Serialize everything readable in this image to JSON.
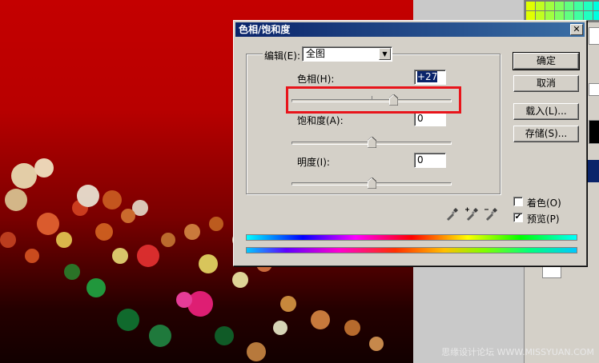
{
  "dialog": {
    "title": "色相/饱和度",
    "close_glyph": "✕",
    "edit_label": "编辑(E):",
    "edit_value": "全图",
    "hue_label": "色相(H):",
    "hue_value": "+27",
    "saturation_label": "饱和度(A):",
    "saturation_value": "0",
    "lightness_label": "明度(I):",
    "lightness_value": "0",
    "buttons": {
      "ok": "确定",
      "cancel": "取消",
      "load": "载入(L)...",
      "save": "存储(S)..."
    },
    "colorize_label": "着色(O)",
    "colorize_checked": false,
    "preview_label": "预览(P)",
    "preview_checked": true
  },
  "watermark": "思缘设计论坛  WWW.MISSYUAN.COM",
  "colors": {
    "highlight": "#e8141b",
    "titlebar": "#0a246a"
  }
}
